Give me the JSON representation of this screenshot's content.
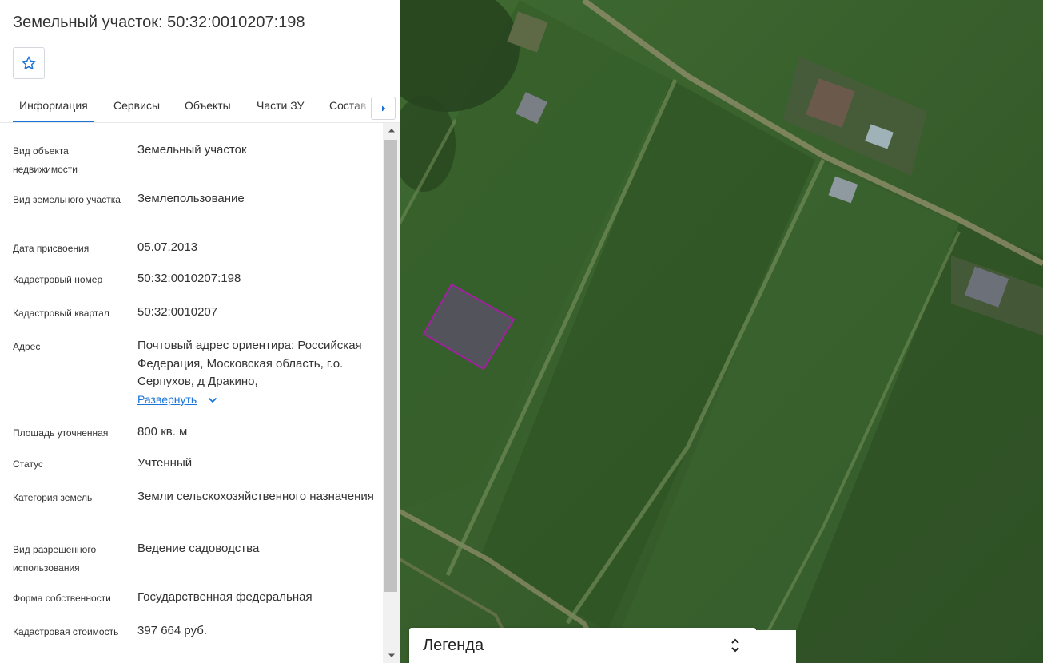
{
  "header": {
    "title": "Земельный участок: 50:32:0010207:198"
  },
  "tabs": [
    {
      "label": "Информация"
    },
    {
      "label": "Сервисы"
    },
    {
      "label": "Объекты"
    },
    {
      "label": "Части ЗУ"
    },
    {
      "label": "Состав"
    }
  ],
  "properties": [
    {
      "label": "Вид объекта недвижимости",
      "value": "Земельный участок"
    },
    {
      "label": "Вид земельного участка",
      "value": "Землепользование"
    },
    {
      "label": "Дата присвоения",
      "value": "05.07.2013"
    },
    {
      "label": "Кадастровый номер",
      "value": "50:32:0010207:198"
    },
    {
      "label": "Кадастровый квартал",
      "value": "50:32:0010207"
    },
    {
      "label": "Адрес",
      "value": "Почтовый адрес ориентира: Российская Федерация, Московская область, г.о. Серпухов, д Дракино,",
      "expand": "Развернуть"
    },
    {
      "label": "Площадь уточненная",
      "value": "800 кв. м"
    },
    {
      "label": "Статус",
      "value": "Учтенный"
    },
    {
      "label": "Категория земель",
      "value": "Земли сельскохозяйственного назначения"
    },
    {
      "label": "Вид разрешенного использования",
      "value": "Ведение садоводства"
    },
    {
      "label": "Форма собственности",
      "value": "Государственная федеральная"
    },
    {
      "label": "Кадастровая стоимость",
      "value": "397 664 руб."
    }
  ],
  "legend": {
    "label": "Легенда"
  },
  "colors": {
    "accent": "#1a73d8",
    "parcel_outline": "#a020a0"
  }
}
